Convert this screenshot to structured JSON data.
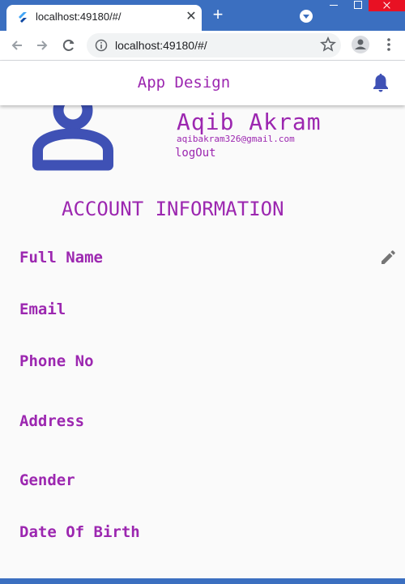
{
  "browser": {
    "tab_title": "localhost:49180/#/",
    "tab_close": "✕",
    "new_tab": "+",
    "url": "localhost:49180/#/"
  },
  "app": {
    "title": "App Design"
  },
  "profile": {
    "name": "Aqib Akram",
    "email": "aqibakram326@gmail.com",
    "logout_label": "logOut"
  },
  "account": {
    "section_title": "ACCOUNT INFORMATION",
    "fields": [
      {
        "label": "Full Name"
      },
      {
        "label": "Email"
      },
      {
        "label": "Phone No"
      },
      {
        "label": "Address"
      },
      {
        "label": "Gender"
      },
      {
        "label": "Date Of Birth"
      }
    ]
  },
  "colors": {
    "accent": "#9c27b0",
    "primary": "#3f51b5",
    "chrome_blue": "#3b6fc0"
  },
  "icons": [
    "flutter-favicon-icon",
    "back-icon",
    "forward-icon",
    "reload-icon",
    "info-icon",
    "star-icon",
    "profile-icon",
    "kebab-menu-icon",
    "bell-icon",
    "avatar-icon",
    "edit-icon"
  ]
}
